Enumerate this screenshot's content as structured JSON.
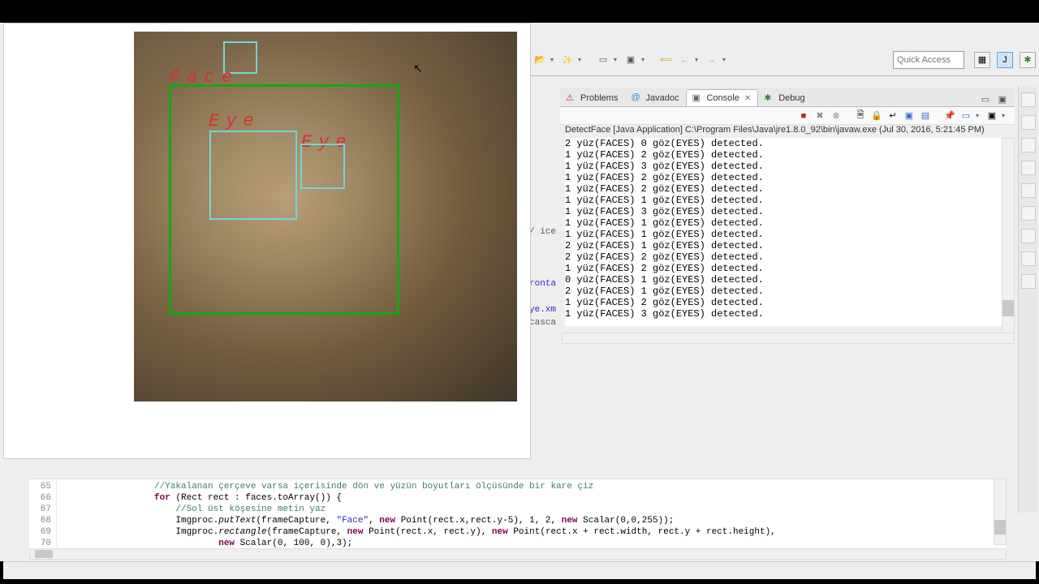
{
  "video": {
    "face_label": "Face",
    "eye_label_1": "Eye",
    "eye_label_2": "Eye"
  },
  "toolbar": {
    "quick_access_placeholder": "Quick Access"
  },
  "tabs": {
    "problems": "Problems",
    "javadoc": "Javadoc",
    "console": "Console",
    "debug": "Debug"
  },
  "console": {
    "header": "DetectFace [Java Application] C:\\Program Files\\Java\\jre1.8.0_92\\bin\\javaw.exe (Jul 30, 2016, 5:21:45 PM)",
    "lines": [
      "2 yüz(FACES) 0 göz(EYES) detected.",
      "1 yüz(FACES) 2 göz(EYES) detected.",
      "1 yüz(FACES) 3 göz(EYES) detected.",
      "1 yüz(FACES) 2 göz(EYES) detected.",
      "1 yüz(FACES) 2 göz(EYES) detected.",
      "1 yüz(FACES) 1 göz(EYES) detected.",
      "1 yüz(FACES) 3 göz(EYES) detected.",
      "1 yüz(FACES) 1 göz(EYES) detected.",
      "1 yüz(FACES) 1 göz(EYES) detected.",
      "2 yüz(FACES) 1 göz(EYES) detected.",
      "2 yüz(FACES) 2 göz(EYES) detected.",
      "1 yüz(FACES) 2 göz(EYES) detected.",
      "0 yüz(FACES) 1 göz(EYES) detected.",
      "2 yüz(FACES) 1 göz(EYES) detected.",
      "1 yüz(FACES) 2 göz(EYES) detected.",
      "1 yüz(FACES) 3 göz(EYES) detected."
    ]
  },
  "code_peek": {
    "l1": "/ ice",
    "l2": "ronta",
    "l3": "ye.xm",
    "l4": "casca"
  },
  "code": {
    "line_numbers": [
      "65",
      "66",
      "67",
      "68",
      "69",
      "70"
    ],
    "l65_comment": "//Yakalanan çerçeve varsa içerisinde dön ve yüzün boyutları ölçüsünde bir kare çiz",
    "l66_for": "for",
    "l66_rest": " (Rect rect : faces.toArray()) {",
    "l67_comment": "//Sol üst köşesine metin yaz",
    "l68_a": "Imgproc.",
    "l68_m": "putText",
    "l68_b": "(frameCapture, ",
    "l68_s": "\"Face\"",
    "l68_c": ", ",
    "l68_n1": "new",
    "l68_d": " Point(rect.x,rect.y-5), 1, 2, ",
    "l68_n2": "new",
    "l68_e": " Scalar(0,0,255));",
    "l69_a": "Imgproc.",
    "l69_m": "rectangle",
    "l69_b": "(frameCapture, ",
    "l69_n1": "new",
    "l69_c": " Point(rect.x, rect.y), ",
    "l69_n2": "new",
    "l69_d": " Point(rect.x + rect.width, rect.y + rect.height),",
    "l70_n": "new",
    "l70_a": " Scalar(0, 100, 0),3);"
  }
}
